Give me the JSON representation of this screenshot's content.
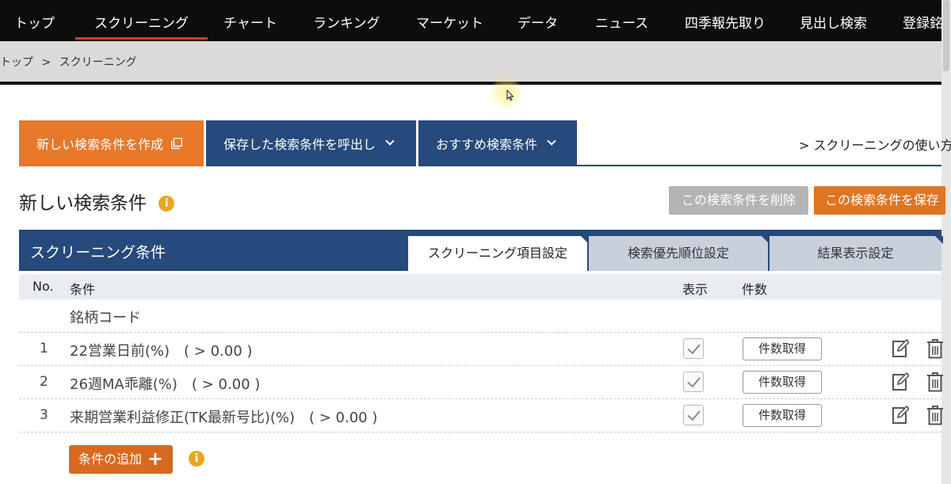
{
  "nav": {
    "items": [
      "トップ",
      "スクリーニング",
      "チャート",
      "ランキング",
      "マーケット",
      "データ",
      "ニュース",
      "四季報先取り",
      "見出し検索",
      "登録銘柄"
    ],
    "active_index": 1
  },
  "breadcrumb": {
    "items": [
      "トップ",
      ">",
      "スクリーニング"
    ]
  },
  "tabs": {
    "new_label": "新しい検索条件を作成",
    "saved_label": "保存した検索条件を呼出し",
    "recommended_label": "おすすめ検索条件",
    "howto_label": "> スクリーニングの使い方"
  },
  "section": {
    "title": "新しい検索条件",
    "delete_label": "この検索条件を削除",
    "save_label": "この検索条件を保存"
  },
  "panel": {
    "title": "スクリーニング条件",
    "subtabs": [
      "スクリーニング項目設定",
      "検索優先順位設定",
      "結果表示設定"
    ]
  },
  "table": {
    "headers": {
      "no": "No.",
      "condition": "条件",
      "display": "表示",
      "count": "件数"
    },
    "code_row": "銘柄コード",
    "rows": [
      {
        "no": "1",
        "condition": "22営業日前(%)　( > 0.00 )",
        "checked": true,
        "count_label": "件数取得"
      },
      {
        "no": "2",
        "condition": "26週MA乖離(%)　( > 0.00 )",
        "checked": true,
        "count_label": "件数取得"
      },
      {
        "no": "3",
        "condition": "来期営業利益修正(TK最新号比)(%)　( > 0.00 )",
        "checked": true,
        "count_label": "件数取得"
      }
    ]
  },
  "add": {
    "label": "条件の追加",
    "plus": "+"
  },
  "info_glyph": "i",
  "colors": {
    "orange": "#e8782a",
    "navy": "#254a7b",
    "info": "#e5a823",
    "nav_active": "#d9372f"
  }
}
